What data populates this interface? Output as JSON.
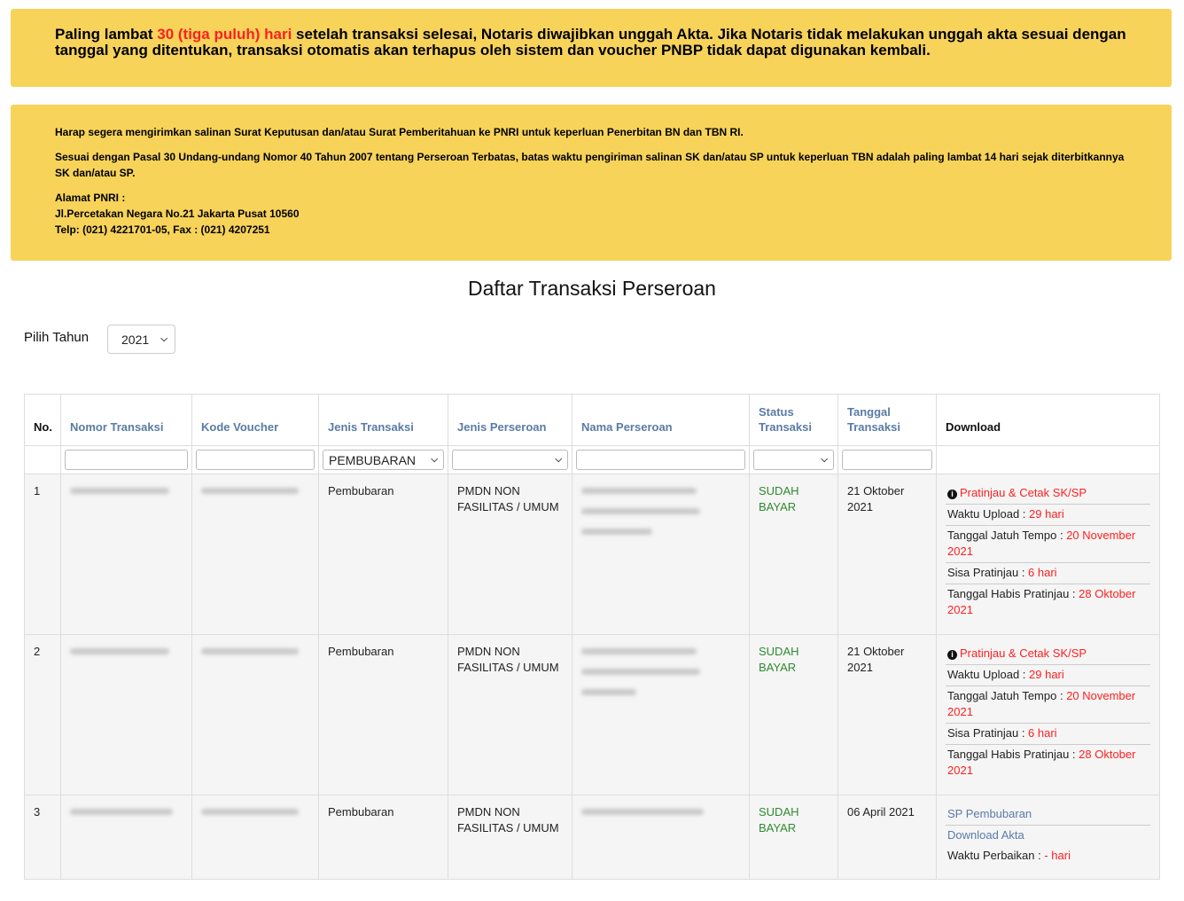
{
  "banner1": {
    "part1": "Paling lambat ",
    "highlight": "30 (tiga puluh) hari",
    "part2": " setelah transaksi selesai, Notaris diwajibkan unggah Akta. Jika Notaris tidak melakukan unggah akta sesuai dengan tanggal yang ditentukan, transaksi otomatis akan terhapus oleh sistem dan voucher PNBP tidak dapat digunakan kembali."
  },
  "banner2": {
    "line1": "Harap segera mengirimkan salinan Surat Keputusan dan/atau Surat Pemberitahuan ke PNRI untuk keperluan Penerbitan BN dan TBN RI.",
    "line2": "Sesuai dengan Pasal 30 Undang-undang Nomor 40 Tahun 2007 tentang Perseroan Terbatas, batas waktu pengiriman salinan SK dan/atau SP untuk keperluan TBN adalah paling lambat 14 hari sejak diterbitkannya SK dan/atau SP.",
    "address_title": "Alamat PNRI :",
    "address_line": "Jl.Percetakan Negara No.21 Jakarta Pusat 10560",
    "phone_line": "Telp: (021) 4221701-05, Fax : (021) 4207251"
  },
  "page_title": "Daftar Transaksi Perseroan",
  "year_filter": {
    "label": "Pilih Tahun",
    "selected": "2021"
  },
  "table": {
    "headers": {
      "no": "No.",
      "nomor": "Nomor Transaksi",
      "kode": "Kode Voucher",
      "jenis_transaksi": "Jenis Transaksi",
      "jenis_perseroan": "Jenis Perseroan",
      "nama": "Nama Perseroan",
      "status": "Status Transaksi",
      "tanggal": "Tanggal Transaksi",
      "download": "Download"
    },
    "filter_jenis_transaksi": "PEMBUBARAN",
    "rows": [
      {
        "no": "1",
        "jenis_transaksi": "Pembubaran",
        "jenis_perseroan": "PMDN NON FASILITAS / UMUM",
        "status": "SUDAH BAYAR",
        "tanggal": "21 Oktober 2021",
        "preview_link": "Pratinjau & Cetak SK/SP",
        "upload_label": "Waktu Upload : ",
        "upload_value": "29 hari",
        "jatuh_tempo_label": "Tanggal Jatuh Tempo : ",
        "jatuh_tempo_value": "20 November 2021",
        "sisa_label": "Sisa Pratinjau : ",
        "sisa_value": "6 hari",
        "habis_label": "Tanggal Habis Pratinjau : ",
        "habis_value": "28 Oktober 2021"
      },
      {
        "no": "2",
        "jenis_transaksi": "Pembubaran",
        "jenis_perseroan": "PMDN NON FASILITAS / UMUM",
        "status": "SUDAH BAYAR",
        "tanggal": "21 Oktober 2021",
        "preview_link": "Pratinjau & Cetak SK/SP",
        "upload_label": "Waktu Upload : ",
        "upload_value": "29 hari",
        "jatuh_tempo_label": "Tanggal Jatuh Tempo : ",
        "jatuh_tempo_value": "20 November 2021",
        "sisa_label": "Sisa Pratinjau : ",
        "sisa_value": "6 hari",
        "habis_label": "Tanggal Habis Pratinjau : ",
        "habis_value": "28 Oktober 2021"
      },
      {
        "no": "3",
        "jenis_transaksi": "Pembubaran",
        "jenis_perseroan": "PMDN NON FASILITAS / UMUM",
        "status": "SUDAH BAYAR",
        "tanggal": "06 April 2021",
        "sp_link": "SP Pembubaran",
        "download_link": "Download Akta",
        "perbaikan_label": "Waktu Perbaikan : ",
        "perbaikan_value": "- hari"
      }
    ]
  }
}
